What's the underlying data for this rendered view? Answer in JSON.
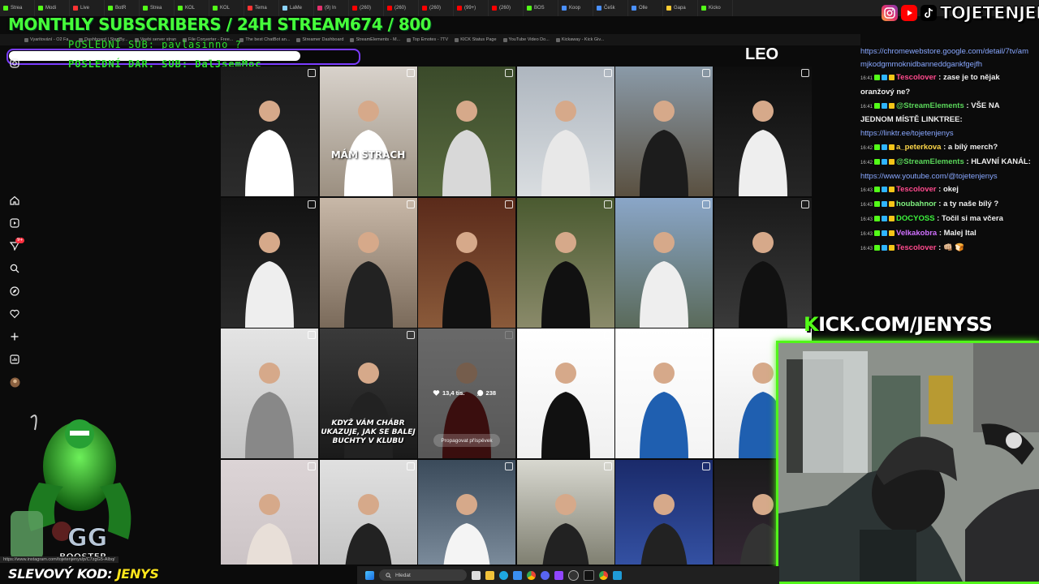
{
  "browser": {
    "tabs": [
      "Strea",
      "Modi",
      "Live",
      "BotR",
      "Strea",
      "KOL",
      "KOL",
      "Tema",
      "LaMe",
      "(9) In",
      "(260)",
      "(260)",
      "(260)",
      "(99+)",
      "(260)",
      "BOS",
      "Koop",
      "Češk",
      "Olle",
      "Gapa",
      "Kicko"
    ],
    "bookmarks": [
      "Vyaritování - O2 Fa...",
      "Dashboard | StartBy...",
      "Veebi server stran",
      "File Converter - Free...",
      "The best ChatBot an...",
      "Streamer Dashboard",
      "StreamElements - M...",
      "Top Emotes - 7TV",
      "KICK Status Page",
      "YouTube Video Do...",
      "Kickaway - Kick Giv..."
    ],
    "status_url": "https://www.instagram.com/tojetenjenys/p/C7zgG5-AIbq/"
  },
  "overlay": {
    "title": "MONTHLY SUBSCRIBERS / 24H STREAM674 / 800",
    "last_sub": "POSLEDNÍ SUB: pavlasinno_?",
    "last_donation": "POSLEDNÍ DAR. SUB: DalJsemMoc",
    "handle": "TOJETENJENYS",
    "kick_prefix": "K",
    "kick_url": "ICK.COM/JENYSS",
    "promo_label": "SLEVOVÝ KOD: ",
    "promo_code": "JENYS",
    "sponsor_text": "GG BOOSTER",
    "progress": 0.8425
  },
  "instagram": {
    "partial_caption": "LEO",
    "tiles": [
      {
        "caption": "",
        "icon": "carousel-icon"
      },
      {
        "caption": "MÁM STRACH",
        "icon": "reel-icon"
      },
      {
        "caption": "",
        "icon": "carousel-icon"
      },
      {
        "caption": "",
        "icon": "carousel-icon"
      },
      {
        "caption": "",
        "icon": "carousel-icon"
      },
      {
        "caption": "",
        "icon": "carousel-icon"
      },
      {
        "caption": "",
        "icon": "carousel-icon"
      },
      {
        "caption": "",
        "icon": "carousel-icon"
      },
      {
        "caption": "",
        "icon": "carousel-icon"
      },
      {
        "caption": "",
        "icon": "carousel-icon"
      },
      {
        "caption": "",
        "icon": "carousel-icon"
      },
      {
        "caption": "",
        "icon": "carousel-icon"
      },
      {
        "caption": "",
        "icon": "carousel-icon"
      },
      {
        "caption": "KDYŽ VÁM CHÁBR UKAZUJE, JAK SE BALEJ BUCHTY V KLUBU",
        "icon": "reel-icon"
      },
      {
        "caption": "",
        "icon": "carousel-icon"
      },
      {
        "caption": "",
        "icon": "carousel-icon"
      },
      {
        "caption": "",
        "icon": "carousel-icon"
      },
      {
        "caption": "",
        "icon": "carousel-icon"
      },
      {
        "caption": "",
        "icon": "carousel-icon"
      },
      {
        "caption": "",
        "icon": "carousel-icon"
      },
      {
        "caption": "",
        "icon": "carousel-icon"
      },
      {
        "caption": "",
        "icon": "carousel-icon"
      },
      {
        "caption": "",
        "icon": "carousel-icon"
      },
      {
        "caption": "",
        "icon": "carousel-icon"
      }
    ],
    "hover": {
      "likes": "13,4 tis.",
      "comments": "238",
      "promote_label": "Propagovat příspěvek"
    },
    "notification_count": "9+"
  },
  "chat": {
    "intro_link": "https://chromewebstore.google.com/detail/7tv/ammjkodgmmoknidbanneddgankfgejfh",
    "messages": [
      {
        "time": "16:41",
        "user": "Tescolover",
        "color": "#ff4a8d",
        "text": "zase je to nějak oranžový ne?"
      },
      {
        "time": "16:41",
        "user": "@StreamElements",
        "color": "#5ad65a",
        "text": "VŠE NA JEDNOM MÍSTĚ LINKTREE:",
        "link": "https://linktr.ee/tojetenjenys"
      },
      {
        "time": "16:42",
        "user": "a_peterkova",
        "color": "#ffd84a",
        "text": "a bílý merch?"
      },
      {
        "time": "16:42",
        "user": "@StreamElements",
        "color": "#5ad65a",
        "text": "HLAVNÍ KANÁL:",
        "link": "https://www.youtube.com/@tojetenjenys"
      },
      {
        "time": "16:43",
        "user": "Tescolover",
        "color": "#ff4a8d",
        "text": "okej"
      },
      {
        "time": "16:43",
        "user": "houbahnor",
        "color": "#7ef07e",
        "text": "a ty naše bílý ?"
      },
      {
        "time": "16:43",
        "user": "DOCYOSS",
        "color": "#3cf23c",
        "text": "Točil si ma včera"
      },
      {
        "time": "16:43",
        "user": "Velkakobra",
        "color": "#d070ff",
        "text": "Malej Ital"
      },
      {
        "time": "16:43",
        "user": "Tescolover",
        "color": "#ff4a8d",
        "text": "👊🏼 🍞"
      }
    ]
  },
  "taskbar": {
    "search_placeholder": "Hledat"
  }
}
